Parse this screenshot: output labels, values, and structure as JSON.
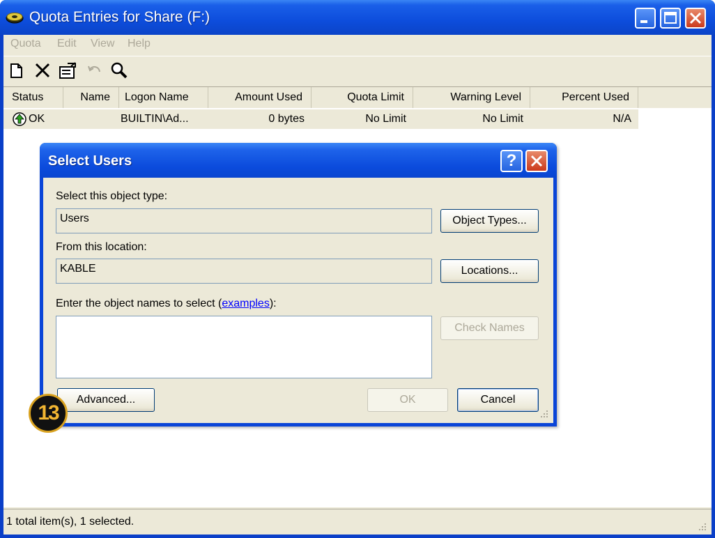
{
  "window": {
    "title": "Quota Entries for Share (F:)",
    "controls": [
      "minimize-icon",
      "maximize-icon",
      "close-icon"
    ]
  },
  "menu": [
    "Quota",
    "Edit",
    "View",
    "Help"
  ],
  "toolbar": {
    "icons": [
      "new-entry-icon",
      "delete-icon",
      "properties-icon",
      "undo-icon",
      "find-icon"
    ]
  },
  "list": {
    "columns": [
      "Status",
      "Name",
      "Logon Name",
      "Amount Used",
      "Quota Limit",
      "Warning Level",
      "Percent Used"
    ],
    "rows": [
      {
        "status": "OK",
        "name": "",
        "logon_name": "BUILTIN\\Ad...",
        "amount_used": "0 bytes",
        "quota_limit": "No Limit",
        "warning_level": "No Limit",
        "percent_used": "N/A"
      }
    ]
  },
  "statusbar": {
    "text": "1 total item(s), 1 selected."
  },
  "dialog": {
    "title": "Select Users",
    "object_type_label": "Select this object type:",
    "object_type_value": "Users",
    "object_types_button": "Object Types...",
    "location_label": "From this location:",
    "location_value": "KABLE",
    "locations_button": "Locations...",
    "names_label_prefix": "Enter the object names to select (",
    "names_label_link": "examples",
    "names_label_suffix": "):",
    "check_names_button": "Check Names",
    "advanced_button": "Advanced...",
    "ok_button": "OK",
    "cancel_button": "Cancel",
    "help_button": "?"
  },
  "annotation": {
    "step": "13"
  },
  "colors": {
    "titlebar": "#0b4bdc",
    "face": "#ece9d8",
    "link": "#0000ff",
    "badge_ring": "#d9a21f"
  }
}
